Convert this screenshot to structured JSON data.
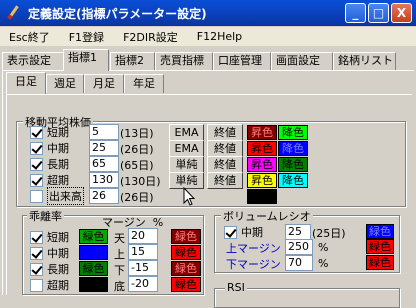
{
  "window": {
    "title": "定義設定(指標パラメーター設定)",
    "min": "_",
    "max": "□",
    "close": "X"
  },
  "menu": [
    "Esc終了",
    "F1登録",
    "F2DIR設定",
    "F12Help"
  ],
  "main_tabs": [
    "表示設定",
    "指標1",
    "指標2",
    "売買指標",
    "口座管理",
    "画面設定",
    "銘柄リスト"
  ],
  "period_tabs": [
    "日足",
    "週足",
    "月足",
    "年足"
  ],
  "ma": {
    "title": "移動平均株価",
    "rows": [
      {
        "label": "短期",
        "value": "5",
        "note": "(13日)",
        "type": "EMA",
        "price": "終値",
        "color1": "昇色",
        "color1_hex": "#800000",
        "color2": "降色",
        "color2_hex": "#00ff00",
        "checked": true
      },
      {
        "label": "中期",
        "value": "25",
        "note": "(26日)",
        "type": "EMA",
        "price": "終値",
        "color1": "昇色",
        "color1_hex": "#ff0000",
        "color2": "降色",
        "color2_hex": "#0000ff",
        "checked": true
      },
      {
        "label": "長期",
        "value": "65",
        "note": "(65日)",
        "type": "単純",
        "price": "終値",
        "color1": "昇色",
        "color1_hex": "#ff00ff",
        "color2": "降色",
        "color2_hex": "#008000",
        "checked": true
      },
      {
        "label": "超期",
        "value": "130",
        "note": "(130日)",
        "type": "単純",
        "price": "終値",
        "color1": "昇色",
        "color1_hex": "#ffff00",
        "color2": "降色",
        "color2_hex": "#00ffff",
        "checked": true
      },
      {
        "label": "出来高",
        "value": "26",
        "note": "(26日)",
        "type": "",
        "price": "",
        "color1": "",
        "color1_hex": "#000000",
        "color2": "",
        "color2_hex": "",
        "checked": false
      }
    ]
  },
  "deviation": {
    "title": "乖離率",
    "header": "マージン  %",
    "rows": [
      {
        "label": "短期",
        "color": "緑色",
        "color_hex": "#00aa00",
        "bound": "天",
        "value": "20",
        "bound_color": "緑色",
        "bound_color_hex": "#800000",
        "checked": true
      },
      {
        "label": "中期",
        "color": "",
        "color_hex": "#0000ff",
        "bound": "上",
        "value": "15",
        "bound_color": "緑色",
        "bound_color_hex": "#ff0000",
        "checked": true
      },
      {
        "label": "長期",
        "color": "緑色",
        "color_hex": "#008000",
        "bound": "下",
        "value": "-15",
        "bound_color": "緑色",
        "bound_color_hex": "#800000",
        "checked": true
      },
      {
        "label": "超期",
        "color": "",
        "color_hex": "#000000",
        "bound": "底",
        "value": "-20",
        "bound_color": "緑色",
        "bound_color_hex": "#ff0000",
        "checked": false
      }
    ]
  },
  "volume_ratio": {
    "title": "ボリュームレシオ",
    "mid_label": "中期",
    "mid_value": "25",
    "mid_note": "(25日)",
    "mid_color": "緑色",
    "mid_color_hex": "#0000ff",
    "upper_label": "上マージン",
    "upper_value": "250",
    "upper_unit": "%",
    "upper_color": "緑色",
    "upper_color_hex": "#ff0000",
    "lower_label": "下マージン",
    "lower_value": "70",
    "lower_unit": "%",
    "lower_color": "緑色",
    "lower_color_hex": "#ff0000"
  },
  "rsi": {
    "title": "RSI"
  }
}
